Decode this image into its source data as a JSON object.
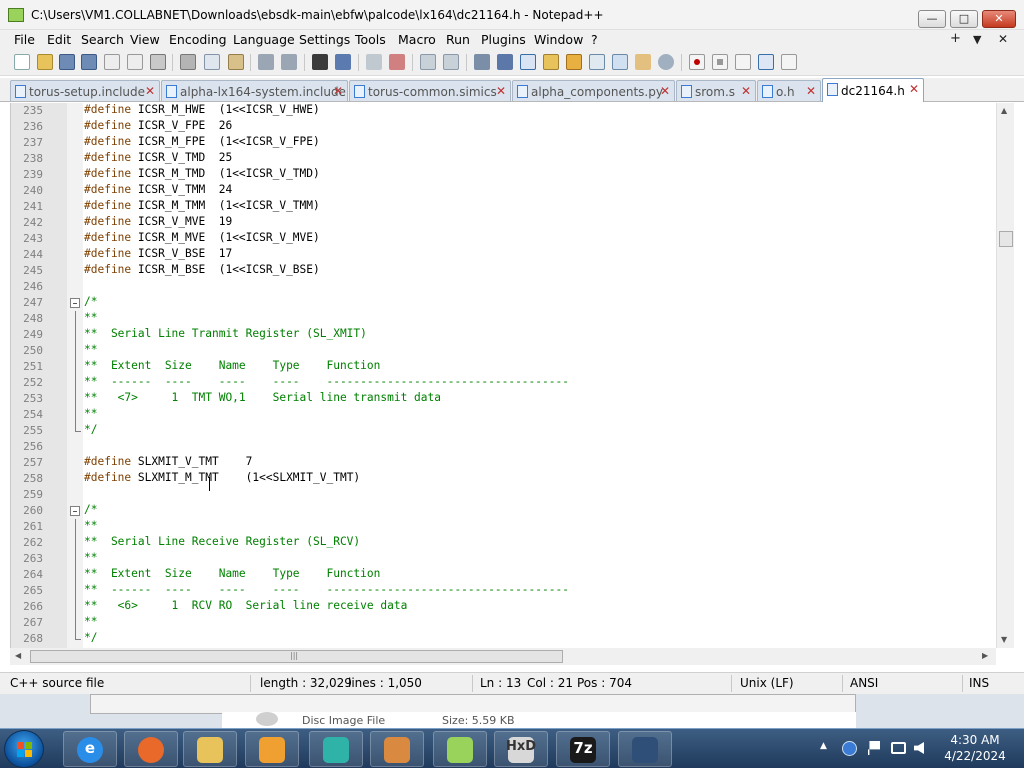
{
  "window": {
    "title": "C:\\Users\\VM1.COLLABNET\\Downloads\\ebsdk-main\\ebfw\\palcode\\lx164\\dc21164.h - Notepad++",
    "min_label": "—",
    "max_label": "□",
    "close_label": "✕"
  },
  "menu": {
    "items": [
      "File",
      "Edit",
      "Search",
      "View",
      "Encoding",
      "Language",
      "Settings",
      "Tools",
      "Macro",
      "Run",
      "Plugins",
      "Window",
      "?"
    ],
    "plus": "+",
    "dropdown": "▼",
    "close": "✕"
  },
  "tabs": [
    {
      "label": "torus-setup.include",
      "close": "✕"
    },
    {
      "label": "alpha-lx164-system.include",
      "close": "✕"
    },
    {
      "label": "torus-common.simics",
      "close": "✕"
    },
    {
      "label": "alpha_components.py",
      "close": "✕"
    },
    {
      "label": "srom.s",
      "close": "✕"
    },
    {
      "label": "o.h",
      "close": "✕"
    },
    {
      "label": "dc21164.h",
      "close": "✕"
    }
  ],
  "editor": {
    "lines": [
      {
        "n": "235",
        "pp": "#define",
        "rest": " ICSR_M_HWE  (1<<ICSR_V_HWE)"
      },
      {
        "n": "236",
        "pp": "#define",
        "rest": " ICSR_V_FPE  26"
      },
      {
        "n": "237",
        "pp": "#define",
        "rest": " ICSR_M_FPE  (1<<ICSR_V_FPE)"
      },
      {
        "n": "238",
        "pp": "#define",
        "rest": " ICSR_V_TMD  25"
      },
      {
        "n": "239",
        "pp": "#define",
        "rest": " ICSR_M_TMD  (1<<ICSR_V_TMD)"
      },
      {
        "n": "240",
        "pp": "#define",
        "rest": " ICSR_V_TMM  24"
      },
      {
        "n": "241",
        "pp": "#define",
        "rest": " ICSR_M_TMM  (1<<ICSR_V_TMM)"
      },
      {
        "n": "242",
        "pp": "#define",
        "rest": " ICSR_V_MVE  19"
      },
      {
        "n": "243",
        "pp": "#define",
        "rest": " ICSR_M_MVE  (1<<ICSR_V_MVE)"
      },
      {
        "n": "244",
        "pp": "#define",
        "rest": " ICSR_V_BSE  17"
      },
      {
        "n": "245",
        "pp": "#define",
        "rest": " ICSR_M_BSE  (1<<ICSR_V_BSE)"
      },
      {
        "n": "246",
        "pp": "",
        "rest": ""
      },
      {
        "n": "247",
        "comment": "/*"
      },
      {
        "n": "248",
        "comment": "**"
      },
      {
        "n": "249",
        "comment": "**  Serial Line Tranmit Register (SL_XMIT)"
      },
      {
        "n": "250",
        "comment": "**"
      },
      {
        "n": "251",
        "comment": "**  Extent  Size    Name    Type    Function"
      },
      {
        "n": "252",
        "comment": "**  ------  ----    ----    ----    ------------------------------------"
      },
      {
        "n": "253",
        "comment": "**   <7>     1  TMT WO,1    Serial line transmit data"
      },
      {
        "n": "254",
        "comment": "**"
      },
      {
        "n": "255",
        "comment": "*/"
      },
      {
        "n": "256",
        "pp": "",
        "rest": ""
      },
      {
        "n": "257",
        "pp": "#define",
        "rest": " SLXMIT_V_TMT    7"
      },
      {
        "n": "258",
        "pp": "#define",
        "rest": " SLXMIT_M_TMT    (1<<SLXMIT_V_TMT)"
      },
      {
        "n": "259",
        "pp": "",
        "rest": ""
      },
      {
        "n": "260",
        "comment": "/*"
      },
      {
        "n": "261",
        "comment": "**"
      },
      {
        "n": "262",
        "comment": "**  Serial Line Receive Register (SL_RCV)"
      },
      {
        "n": "263",
        "comment": "**"
      },
      {
        "n": "264",
        "comment": "**  Extent  Size    Name    Type    Function"
      },
      {
        "n": "265",
        "comment": "**  ------  ----    ----    ----    ------------------------------------"
      },
      {
        "n": "266",
        "comment": "**   <6>     1  RCV RO  Serial line receive data"
      },
      {
        "n": "267",
        "comment": "**"
      },
      {
        "n": "268",
        "comment": "*/"
      }
    ]
  },
  "statusbar": {
    "file_type": "C++ source file",
    "length": "length : 32,029",
    "lines": "lines : 1,050",
    "ln": "Ln : 13",
    "col": "Col : 21",
    "pos": "Pos : 704",
    "eol": "Unix (LF)",
    "encoding": "ANSI",
    "mode": "INS"
  },
  "background_window": {
    "col1": "Disc Image File",
    "col2": "Size: 5.59 KB"
  },
  "taskbar": {
    "apps": [
      {
        "name": "internet-explorer",
        "glyph": "e",
        "color": "#2a8ee8"
      },
      {
        "name": "firefox",
        "glyph": "",
        "color": "#e8692a"
      },
      {
        "name": "file-explorer",
        "glyph": "",
        "color": "#e8c25a"
      },
      {
        "name": "media-player",
        "glyph": "",
        "color": "#f0a030"
      },
      {
        "name": "app-teal",
        "glyph": "",
        "color": "#2fb3a8"
      },
      {
        "name": "app-anaconda",
        "glyph": "",
        "color": "#d98a40"
      },
      {
        "name": "notepad-plus-plus",
        "glyph": "",
        "color": "#9ad35b"
      },
      {
        "name": "hxd",
        "glyph": "HxD",
        "color": "#d8d8d8"
      },
      {
        "name": "7zip",
        "glyph": "7z",
        "color": "#1a1a1a"
      },
      {
        "name": "remote-desktop",
        "glyph": "",
        "color": "#2f4f78"
      }
    ],
    "clock_time": "4:30 AM",
    "clock_date": "4/22/2024"
  }
}
